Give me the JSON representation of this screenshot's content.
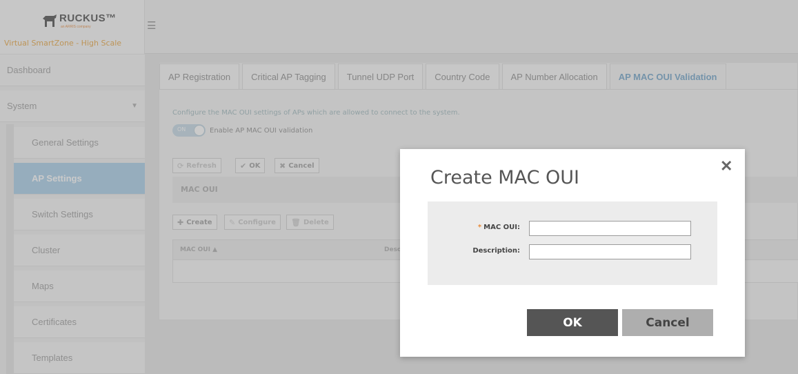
{
  "header": {
    "logo_text": "RUCKUS™",
    "logo_sub": "an ARRIS company",
    "product_name": "Virtual SmartZone - High Scale",
    "menu_icon": "hamburger-icon"
  },
  "sidebar": {
    "items": [
      {
        "label": "Dashboard"
      },
      {
        "label": "System",
        "caret": "▼"
      },
      {
        "label": "General Settings"
      },
      {
        "label": "AP Settings"
      },
      {
        "label": "Switch Settings"
      },
      {
        "label": "Cluster"
      },
      {
        "label": "Maps"
      },
      {
        "label": "Certificates"
      },
      {
        "label": "Templates"
      }
    ],
    "active_item": "AP Settings"
  },
  "tabs": [
    {
      "label": "AP Registration"
    },
    {
      "label": "Critical AP Tagging"
    },
    {
      "label": "Tunnel UDP Port"
    },
    {
      "label": "Country Code"
    },
    {
      "label": "AP Number Allocation"
    },
    {
      "label": "AP MAC OUI Validation"
    }
  ],
  "active_tab": "AP MAC OUI Validation",
  "content": {
    "description": "Configure the MAC OUI settings of APs which are allowed to connect to the system.",
    "toggle_state": "ON",
    "toggle_label": "Enable AP MAC OUI validation",
    "top_buttons": {
      "refresh": "Refresh",
      "ok": "OK",
      "cancel": "Cancel"
    },
    "section_title": "MAC OUI",
    "list_buttons": {
      "create": "Create",
      "configure": "Configure",
      "delete": "Delete"
    },
    "table_headers": [
      "MAC OUI ▲",
      "Desc"
    ]
  },
  "modal": {
    "title": "Create MAC OUI",
    "close": "✕",
    "fields": {
      "mac_oui": {
        "label": "MAC OUI:",
        "required_mark": "*",
        "value": ""
      },
      "description": {
        "label": "Description:",
        "value": ""
      }
    },
    "ok_label": "OK",
    "cancel_label": "Cancel"
  },
  "colors": {
    "accent": "#6ba1c8",
    "active_sidebar": "#a6cde9",
    "required": "#e88a38",
    "ok_button": "#555555",
    "cancel_button": "#aeaeae"
  }
}
